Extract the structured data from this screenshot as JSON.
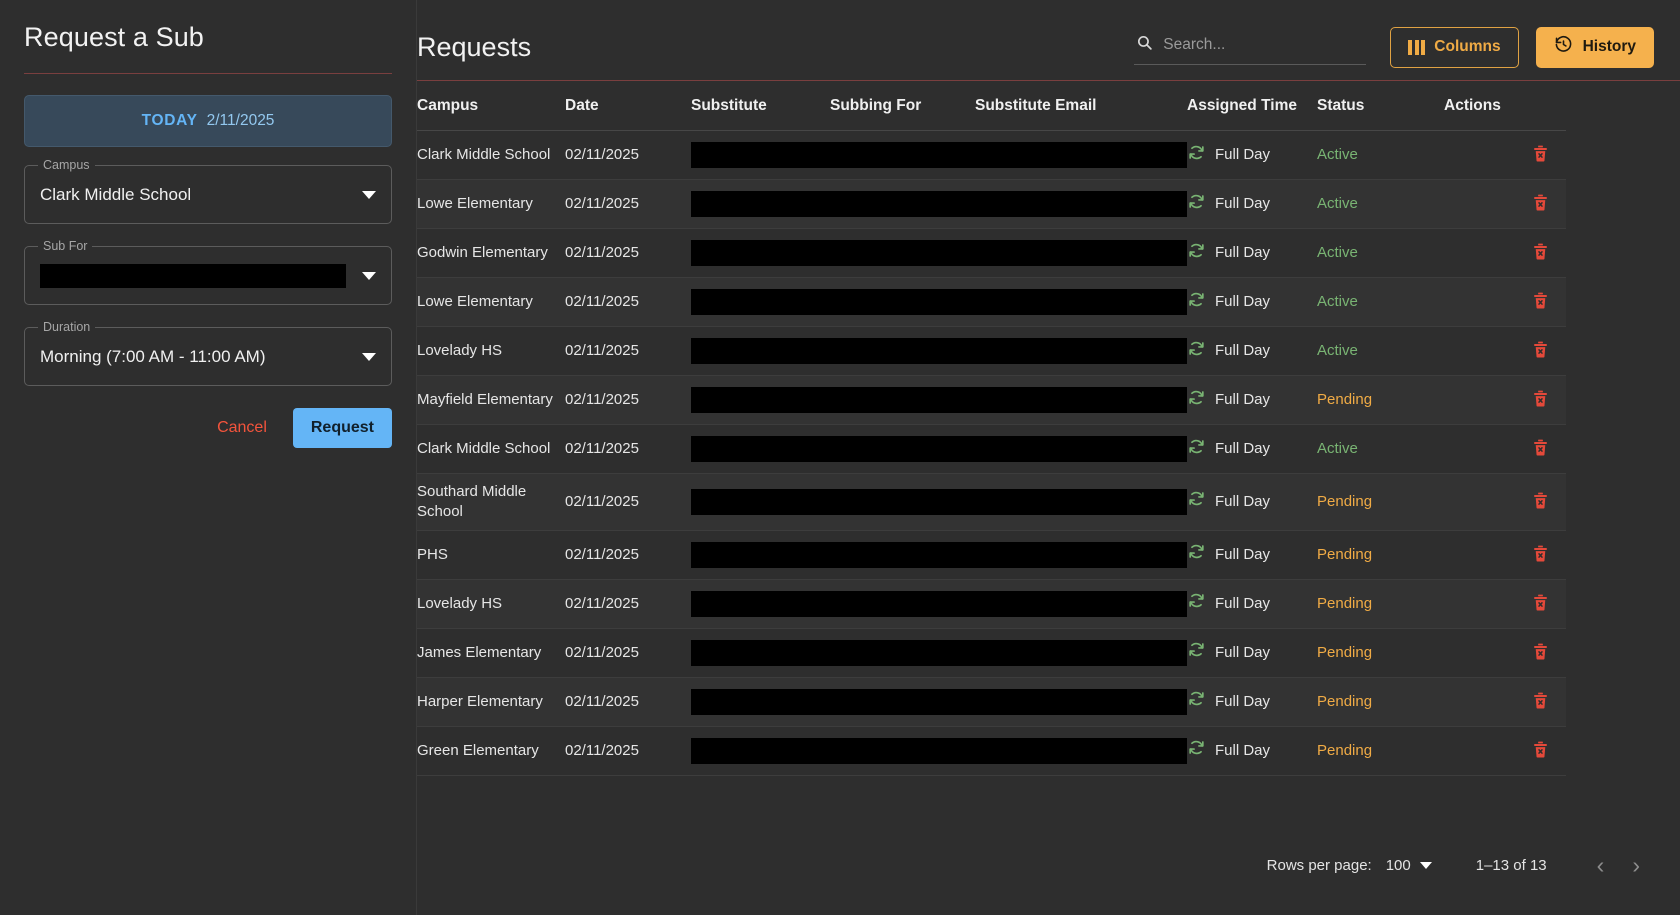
{
  "left_panel": {
    "title": "Request a Sub",
    "today": {
      "label": "TODAY",
      "date": "2/11/2025"
    },
    "fields": [
      {
        "legend": "Campus",
        "value": "Clark Middle School",
        "redacted": false
      },
      {
        "legend": "Sub For",
        "value": "",
        "redacted": true
      },
      {
        "legend": "Duration",
        "value": "Morning (7:00 AM - 11:00 AM)",
        "redacted": false
      }
    ],
    "cancel_label": "Cancel",
    "request_label": "Request"
  },
  "main": {
    "title": "Requests",
    "search": {
      "placeholder": "Search...",
      "value": ""
    },
    "columns_label": "Columns",
    "history_label": "History",
    "table": {
      "headers": [
        "Campus",
        "Date",
        "Substitute",
        "Subbing For",
        "Substitute Email",
        "Assigned Time",
        "Status",
        "Actions"
      ],
      "rows": [
        {
          "campus": "Clark Middle School",
          "date": "02/11/2025",
          "substitute": "",
          "subbing_for": "",
          "email": "",
          "assigned_time": "Full Day",
          "status": "Active",
          "redacted": true
        },
        {
          "campus": "Lowe Elementary",
          "date": "02/11/2025",
          "substitute": "",
          "subbing_for": "",
          "email": "",
          "assigned_time": "Full Day",
          "status": "Active",
          "redacted": true
        },
        {
          "campus": "Godwin Elementary",
          "date": "02/11/2025",
          "substitute": "",
          "subbing_for": "",
          "email": "",
          "assigned_time": "Full Day",
          "status": "Active",
          "redacted": true
        },
        {
          "campus": "Lowe Elementary",
          "date": "02/11/2025",
          "substitute": "",
          "subbing_for": "",
          "email": "",
          "assigned_time": "Full Day",
          "status": "Active",
          "redacted": true
        },
        {
          "campus": "Lovelady HS",
          "date": "02/11/2025",
          "substitute": "",
          "subbing_for": "",
          "email": "",
          "assigned_time": "Full Day",
          "status": "Active",
          "redacted": true
        },
        {
          "campus": "Mayfield Elementary",
          "date": "02/11/2025",
          "substitute": "",
          "subbing_for": "",
          "email": "",
          "assigned_time": "Full Day",
          "status": "Pending",
          "redacted": true
        },
        {
          "campus": "Clark Middle School",
          "date": "02/11/2025",
          "substitute": "",
          "subbing_for": "",
          "email": "",
          "assigned_time": "Full Day",
          "status": "Active",
          "redacted": true
        },
        {
          "campus": "Southard Middle School",
          "date": "02/11/2025",
          "substitute": "",
          "subbing_for": "",
          "email": "",
          "assigned_time": "Full Day",
          "status": "Pending",
          "redacted": true
        },
        {
          "campus": "PHS",
          "date": "02/11/2025",
          "substitute": "",
          "subbing_for": "",
          "email": "",
          "assigned_time": "Full Day",
          "status": "Pending",
          "redacted": true
        },
        {
          "campus": "Lovelady HS",
          "date": "02/11/2025",
          "substitute": "",
          "subbing_for": "",
          "email": "",
          "assigned_time": "Full Day",
          "status": "Pending",
          "redacted": true
        },
        {
          "campus": "James Elementary",
          "date": "02/11/2025",
          "substitute": "",
          "subbing_for": "",
          "email": "",
          "assigned_time": "Full Day",
          "status": "Pending",
          "redacted": true
        },
        {
          "campus": "Harper Elementary",
          "date": "02/11/2025",
          "substitute": "",
          "subbing_for": "",
          "email": "",
          "assigned_time": "Full Day",
          "status": "Pending",
          "redacted": true
        },
        {
          "campus": "Green Elementary",
          "date": "02/11/2025",
          "substitute": "",
          "subbing_for": "",
          "email": "",
          "assigned_time": "Full Day",
          "status": "Pending",
          "redacted": true
        }
      ]
    },
    "pagination": {
      "rows_per_page_label": "Rows per page:",
      "rows_per_page_value": "100",
      "range_label": "1–13 of 13",
      "prev_glyph": "‹",
      "next_glyph": "›"
    }
  },
  "colors": {
    "accent_orange": "#f5b14d",
    "accent_blue": "#64b5f6",
    "status_active": "#79b473",
    "status_pending": "#f0ab45",
    "danger_red": "#e4493a",
    "page_bg": "#2e2e2e"
  }
}
